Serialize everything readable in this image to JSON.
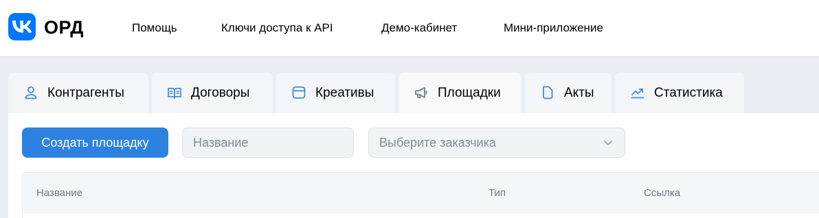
{
  "header": {
    "logo_text": "ОРД",
    "nav": [
      "Помощь",
      "Ключи доступа к API",
      "Демо-кабинет",
      "Мини-приложение"
    ]
  },
  "tabs": [
    {
      "label": "Контрагенты",
      "icon": "user-icon"
    },
    {
      "label": "Договоры",
      "icon": "book-icon"
    },
    {
      "label": "Креативы",
      "icon": "card-icon"
    },
    {
      "label": "Площадки",
      "icon": "megaphone-icon",
      "active": true
    },
    {
      "label": "Акты",
      "icon": "document-icon"
    },
    {
      "label": "Статистика",
      "icon": "chart-icon"
    }
  ],
  "toolbar": {
    "create_label": "Создать площадку",
    "name_placeholder": "Название",
    "customer_placeholder": "Выберите заказчика"
  },
  "table": {
    "columns": [
      "Название",
      "Тип",
      "Ссылка"
    ]
  },
  "colors": {
    "brand": "#0077ff",
    "primary_button": "#2d81e0",
    "icon_blue": "#3f8ae0"
  }
}
